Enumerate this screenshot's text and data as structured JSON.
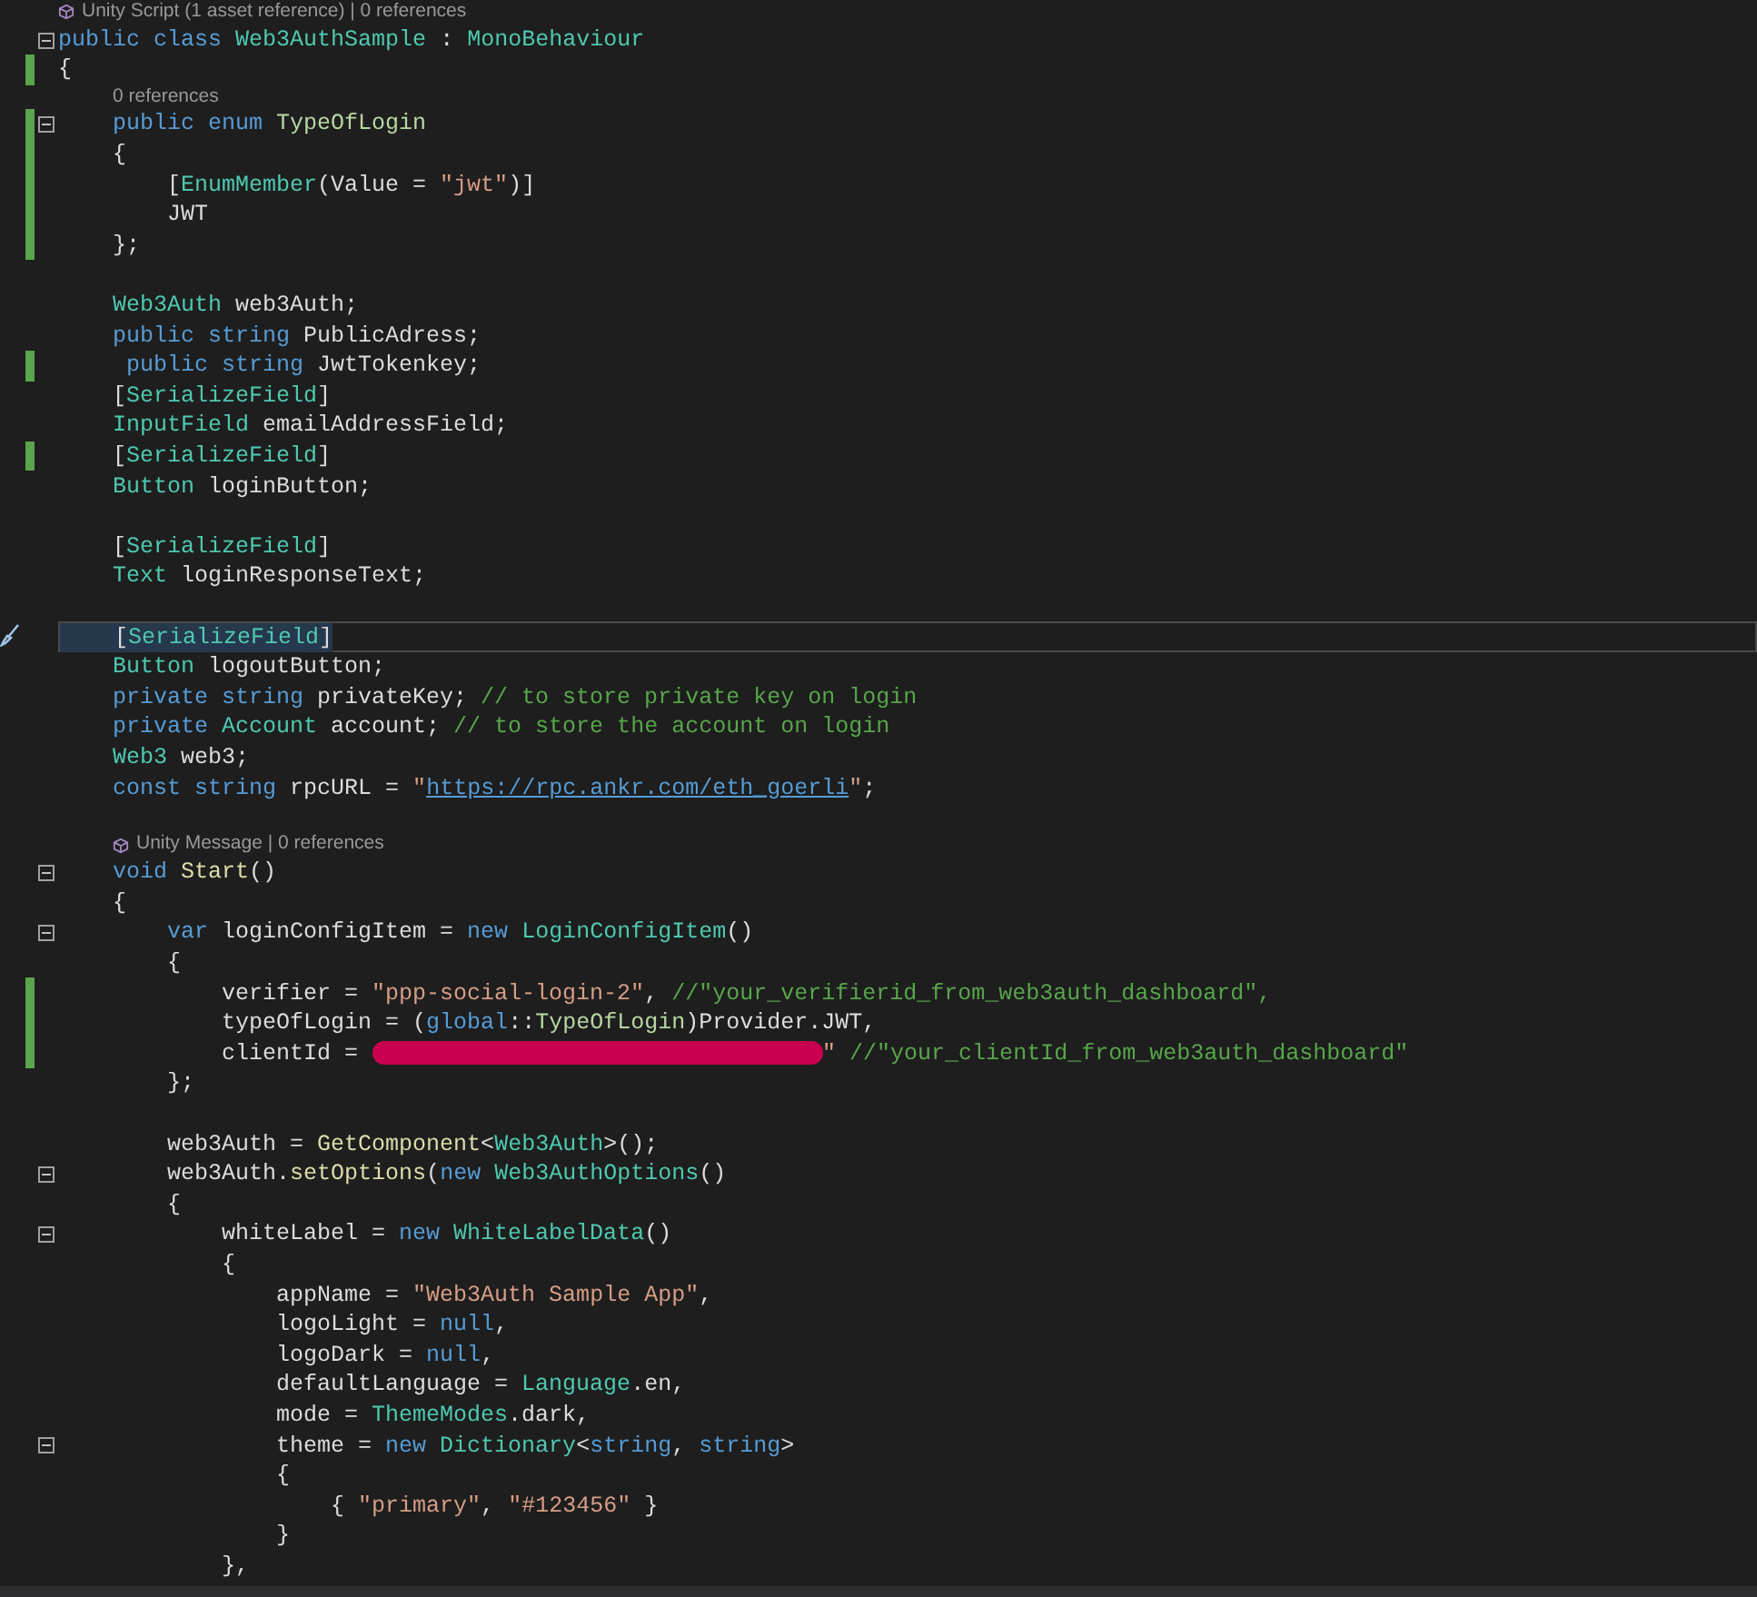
{
  "editor": {
    "lines": [
      {
        "kind": "codelens",
        "icon": true,
        "text": "Unity Script (1 asset reference) | 0 references"
      },
      {
        "kind": "code",
        "fold": true,
        "tokens": [
          {
            "kind": "kw",
            "text": "public class "
          },
          {
            "kind": "type",
            "text": "Web3AuthSample"
          },
          {
            "kind": "plain",
            "text": " : "
          },
          {
            "kind": "type",
            "text": "MonoBehaviour"
          }
        ]
      },
      {
        "kind": "code",
        "changed": true,
        "tokens": [
          {
            "kind": "plain",
            "text": "{"
          }
        ]
      },
      {
        "kind": "codelens",
        "indented": true,
        "text": "0 references"
      },
      {
        "kind": "code",
        "fold": true,
        "changed": true,
        "tokens": [
          {
            "kind": "kw",
            "text": "    public enum "
          },
          {
            "kind": "enum",
            "text": "TypeOfLogin"
          }
        ]
      },
      {
        "kind": "code",
        "changed": true,
        "tokens": [
          {
            "kind": "plain",
            "text": "    {"
          }
        ]
      },
      {
        "kind": "code",
        "changed": true,
        "tokens": [
          {
            "kind": "plain",
            "text": "        ["
          },
          {
            "kind": "type",
            "text": "EnumMember"
          },
          {
            "kind": "plain",
            "text": "(Value = "
          },
          {
            "kind": "str",
            "text": "\"jwt\""
          },
          {
            "kind": "plain",
            "text": ")]"
          }
        ]
      },
      {
        "kind": "code",
        "changed": true,
        "tokens": [
          {
            "kind": "plain",
            "text": "        JWT"
          }
        ]
      },
      {
        "kind": "code",
        "changed": true,
        "tokens": [
          {
            "kind": "plain",
            "text": "    };"
          }
        ]
      },
      {
        "kind": "code"
      },
      {
        "kind": "code",
        "tokens": [
          {
            "kind": "type",
            "text": "    Web3Auth"
          },
          {
            "kind": "plain",
            "text": " web3Auth;"
          }
        ]
      },
      {
        "kind": "code",
        "tokens": [
          {
            "kind": "kw",
            "text": "    public string "
          },
          {
            "kind": "plain",
            "text": "PublicAdress;"
          }
        ]
      },
      {
        "kind": "code",
        "changed": true,
        "tokens": [
          {
            "kind": "kw",
            "text": "     public string "
          },
          {
            "kind": "plain",
            "text": "JwtTokenkey;"
          }
        ]
      },
      {
        "kind": "code",
        "tokens": [
          {
            "kind": "plain",
            "text": "    ["
          },
          {
            "kind": "type",
            "text": "SerializeField"
          },
          {
            "kind": "plain",
            "text": "]"
          }
        ]
      },
      {
        "kind": "code",
        "tokens": [
          {
            "kind": "type",
            "text": "    InputField"
          },
          {
            "kind": "plain",
            "text": " emailAddressField;"
          }
        ]
      },
      {
        "kind": "code",
        "changed": true,
        "tokens": [
          {
            "kind": "plain",
            "text": "    ["
          },
          {
            "kind": "type",
            "text": "SerializeField"
          },
          {
            "kind": "plain",
            "text": "]"
          }
        ]
      },
      {
        "kind": "code",
        "tokens": [
          {
            "kind": "type",
            "text": "    Button"
          },
          {
            "kind": "plain",
            "text": " loginButton;"
          }
        ]
      },
      {
        "kind": "code"
      },
      {
        "kind": "code",
        "tokens": [
          {
            "kind": "plain",
            "text": "    ["
          },
          {
            "kind": "type",
            "text": "SerializeField"
          },
          {
            "kind": "plain",
            "text": "]"
          }
        ]
      },
      {
        "kind": "code",
        "tokens": [
          {
            "kind": "type",
            "text": "    Text"
          },
          {
            "kind": "plain",
            "text": " loginResponseText;"
          }
        ]
      },
      {
        "kind": "code"
      },
      {
        "kind": "code",
        "current": true,
        "tokens": [
          {
            "kind": "plain",
            "text": "    ["
          },
          {
            "kind": "type",
            "text": "SerializeField"
          },
          {
            "kind": "plain",
            "text": "]"
          }
        ]
      },
      {
        "kind": "code",
        "tokens": [
          {
            "kind": "type",
            "text": "    Button"
          },
          {
            "kind": "plain",
            "text": " logoutButton;"
          }
        ]
      },
      {
        "kind": "code",
        "tokens": [
          {
            "kind": "kw",
            "text": "    private string "
          },
          {
            "kind": "plain",
            "text": "privateKey; "
          },
          {
            "kind": "comment",
            "text": "// to store private key on login"
          }
        ]
      },
      {
        "kind": "code",
        "tokens": [
          {
            "kind": "kw",
            "text": "    private "
          },
          {
            "kind": "type",
            "text": "Account"
          },
          {
            "kind": "plain",
            "text": " account; "
          },
          {
            "kind": "comment",
            "text": "// to store the account on login"
          }
        ]
      },
      {
        "kind": "code",
        "tokens": [
          {
            "kind": "type",
            "text": "    Web3"
          },
          {
            "kind": "plain",
            "text": " web3;"
          }
        ]
      },
      {
        "kind": "code",
        "tokens": [
          {
            "kind": "kw",
            "text": "    const string "
          },
          {
            "kind": "plain",
            "text": "rpcURL = "
          },
          {
            "kind": "str",
            "text": "\""
          },
          {
            "kind": "link",
            "text": "https://rpc.ankr.com/eth_goerli"
          },
          {
            "kind": "str",
            "text": "\""
          },
          {
            "kind": "plain",
            "text": ";"
          }
        ]
      },
      {
        "kind": "code"
      },
      {
        "kind": "codelens",
        "indented": true,
        "icon": true,
        "text": "Unity Message | 0 references"
      },
      {
        "kind": "code",
        "fold": true,
        "tokens": [
          {
            "kind": "kw",
            "text": "    void "
          },
          {
            "kind": "method",
            "text": "Start"
          },
          {
            "kind": "plain",
            "text": "()"
          }
        ]
      },
      {
        "kind": "code",
        "tokens": [
          {
            "kind": "plain",
            "text": "    {"
          }
        ]
      },
      {
        "kind": "code",
        "fold": true,
        "tokens": [
          {
            "kind": "kw",
            "text": "        var "
          },
          {
            "kind": "plain",
            "text": "loginConfigItem = "
          },
          {
            "kind": "kw",
            "text": "new "
          },
          {
            "kind": "type",
            "text": "LoginConfigItem"
          },
          {
            "kind": "plain",
            "text": "()"
          }
        ]
      },
      {
        "kind": "code",
        "tokens": [
          {
            "kind": "plain",
            "text": "        {"
          }
        ]
      },
      {
        "kind": "code",
        "changed": true,
        "tokens": [
          {
            "kind": "plain",
            "text": "            verifier = "
          },
          {
            "kind": "str",
            "text": "\"ppp-social-login-2\""
          },
          {
            "kind": "plain",
            "text": ", "
          },
          {
            "kind": "comment",
            "text": "//\"your_verifierid_from_web3auth_dashboard\","
          }
        ]
      },
      {
        "kind": "code",
        "changed": true,
        "tokens": [
          {
            "kind": "plain",
            "text": "            typeOfLogin = ("
          },
          {
            "kind": "kw",
            "text": "global"
          },
          {
            "kind": "plain",
            "text": "::"
          },
          {
            "kind": "enum",
            "text": "TypeOfLogin"
          },
          {
            "kind": "plain",
            "text": ")Provider.JWT,"
          }
        ]
      },
      {
        "kind": "code",
        "changed": true,
        "tokens": [
          {
            "kind": "plain",
            "text": "            clientId = "
          },
          {
            "kind": "redaction"
          },
          {
            "kind": "str",
            "text": "\""
          },
          {
            "kind": "comment",
            "text": " //\"your_clientId_from_web3auth_dashboard\""
          }
        ]
      },
      {
        "kind": "code",
        "tokens": [
          {
            "kind": "plain",
            "text": "        };"
          }
        ]
      },
      {
        "kind": "code"
      },
      {
        "kind": "code",
        "tokens": [
          {
            "kind": "plain",
            "text": "        web3Auth = "
          },
          {
            "kind": "method",
            "text": "GetComponent"
          },
          {
            "kind": "plain",
            "text": "<"
          },
          {
            "kind": "type",
            "text": "Web3Auth"
          },
          {
            "kind": "plain",
            "text": ">();"
          }
        ]
      },
      {
        "kind": "code",
        "fold": true,
        "tokens": [
          {
            "kind": "plain",
            "text": "        web3Auth."
          },
          {
            "kind": "method",
            "text": "setOptions"
          },
          {
            "kind": "plain",
            "text": "("
          },
          {
            "kind": "kw",
            "text": "new "
          },
          {
            "kind": "type",
            "text": "Web3AuthOptions"
          },
          {
            "kind": "plain",
            "text": "()"
          }
        ]
      },
      {
        "kind": "code",
        "tokens": [
          {
            "kind": "plain",
            "text": "        {"
          }
        ]
      },
      {
        "kind": "code",
        "fold": true,
        "tokens": [
          {
            "kind": "plain",
            "text": "            whiteLabel = "
          },
          {
            "kind": "kw",
            "text": "new "
          },
          {
            "kind": "type",
            "text": "WhiteLabelData"
          },
          {
            "kind": "plain",
            "text": "()"
          }
        ]
      },
      {
        "kind": "code",
        "tokens": [
          {
            "kind": "plain",
            "text": "            {"
          }
        ]
      },
      {
        "kind": "code",
        "tokens": [
          {
            "kind": "plain",
            "text": "                appName = "
          },
          {
            "kind": "str",
            "text": "\"Web3Auth Sample App\""
          },
          {
            "kind": "plain",
            "text": ","
          }
        ]
      },
      {
        "kind": "code",
        "tokens": [
          {
            "kind": "plain",
            "text": "                logoLight = "
          },
          {
            "kind": "kw",
            "text": "null"
          },
          {
            "kind": "plain",
            "text": ","
          }
        ]
      },
      {
        "kind": "code",
        "tokens": [
          {
            "kind": "plain",
            "text": "                logoDark = "
          },
          {
            "kind": "kw",
            "text": "null"
          },
          {
            "kind": "plain",
            "text": ","
          }
        ]
      },
      {
        "kind": "code",
        "tokens": [
          {
            "kind": "plain",
            "text": "                defaultLanguage = "
          },
          {
            "kind": "type",
            "text": "Language"
          },
          {
            "kind": "plain",
            "text": ".en,"
          }
        ]
      },
      {
        "kind": "code",
        "tokens": [
          {
            "kind": "plain",
            "text": "                mode = "
          },
          {
            "kind": "type",
            "text": "ThemeModes"
          },
          {
            "kind": "plain",
            "text": ".dark,"
          }
        ]
      },
      {
        "kind": "code",
        "fold": true,
        "tokens": [
          {
            "kind": "plain",
            "text": "                theme = "
          },
          {
            "kind": "kw",
            "text": "new "
          },
          {
            "kind": "type",
            "text": "Dictionary"
          },
          {
            "kind": "plain",
            "text": "<"
          },
          {
            "kind": "kw",
            "text": "string"
          },
          {
            "kind": "plain",
            "text": ", "
          },
          {
            "kind": "kw",
            "text": "string"
          },
          {
            "kind": "plain",
            "text": ">"
          }
        ]
      },
      {
        "kind": "code",
        "tokens": [
          {
            "kind": "plain",
            "text": "                {"
          }
        ]
      },
      {
        "kind": "code",
        "tokens": [
          {
            "kind": "plain",
            "text": "                    { "
          },
          {
            "kind": "str",
            "text": "\"primary\""
          },
          {
            "kind": "plain",
            "text": ", "
          },
          {
            "kind": "str",
            "text": "\"#123456\""
          },
          {
            "kind": "plain",
            "text": " }"
          }
        ]
      },
      {
        "kind": "code",
        "tokens": [
          {
            "kind": "plain",
            "text": "                }"
          }
        ]
      },
      {
        "kind": "code",
        "tokens": [
          {
            "kind": "plain",
            "text": "            },"
          }
        ]
      }
    ]
  }
}
